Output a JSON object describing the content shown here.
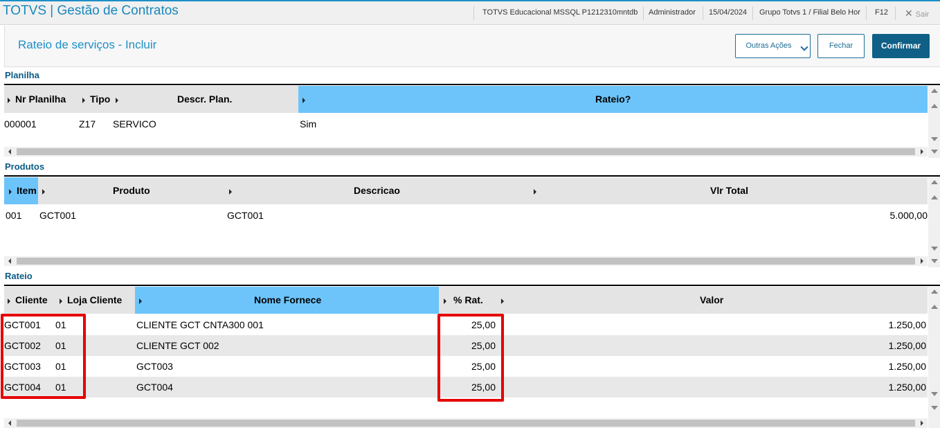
{
  "topbar": {
    "app_title": "TOTVS | Gestão de Contratos",
    "environment": "TOTVS Educacional MSSQL P1212310mntdb",
    "user": "Administrador",
    "date": "15/04/2024",
    "branch": "Grupo Totvs 1 / Filial Belo Hor",
    "shortcut": "F12",
    "exit_label": "Sair"
  },
  "header": {
    "title": "Rateio de serviços - Incluir",
    "other_actions_label": "Outras Ações",
    "close_label": "Fechar",
    "confirm_label": "Confirmar"
  },
  "planilha": {
    "title": "Planilha",
    "columns": [
      "Nr Planilha",
      "Tipo",
      "Descr. Plan.",
      "Rateio?"
    ],
    "rows": [
      [
        "000001",
        "Z17",
        "SERVICO",
        "Sim"
      ]
    ]
  },
  "produtos": {
    "title": "Produtos",
    "columns": [
      "Item",
      "Produto",
      "Descricao",
      "Vlr Total"
    ],
    "rows": [
      [
        "001",
        "GCT001",
        "GCT001",
        "5.000,00"
      ]
    ]
  },
  "rateio": {
    "title": "Rateio",
    "columns": [
      "Cliente",
      "Loja Cliente",
      "Nome Fornece",
      "% Rat.",
      "Valor"
    ],
    "rows": [
      [
        "GCT001",
        "01",
        "CLIENTE GCT CNTA300 001",
        "25,00",
        "1.250,00"
      ],
      [
        "GCT002",
        "01",
        "CLIENTE GCT 002",
        "25,00",
        "1.250,00"
      ],
      [
        "GCT003",
        "01",
        "GCT003",
        "25,00",
        "1.250,00"
      ],
      [
        "GCT004",
        "01",
        "GCT004",
        "25,00",
        "1.250,00"
      ]
    ]
  },
  "colors": {
    "brand": "#1d8fc7",
    "primary_button": "#105f87",
    "selected_header": "#6cc4fb",
    "highlight": "#e60000"
  }
}
